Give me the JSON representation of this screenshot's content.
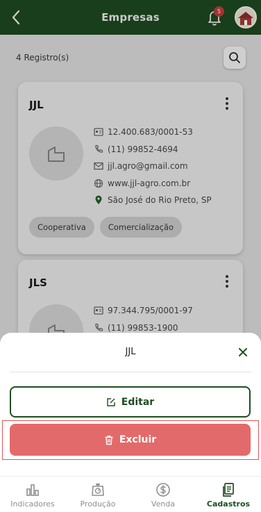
{
  "header": {
    "title": "Empresas",
    "notification_count": "5"
  },
  "list": {
    "count_label": "4 Registro(s)"
  },
  "companies": [
    {
      "name": "JJL",
      "cnpj": "12.400.683/0001-53",
      "phone": "(11) 99852-4694",
      "email": "jjl.agro@gmail.com",
      "website": "www.jjl-agro.com.br",
      "location": "São José do Rio Preto, SP",
      "tags": [
        "Cooperativa",
        "Comercialização"
      ]
    },
    {
      "name": "JLS",
      "cnpj": "97.344.795/0001-97",
      "phone": "(11) 99853-1900"
    }
  ],
  "sheet": {
    "title": "JJL",
    "edit_label": "Editar",
    "delete_label": "Excluir"
  },
  "nav": {
    "items": [
      {
        "label": "Indicadores"
      },
      {
        "label": "Produção"
      },
      {
        "label": "Venda"
      },
      {
        "label": "Cadastros"
      }
    ]
  },
  "colors": {
    "header_bg": "#193e1b",
    "primary_green": "#1f4d22",
    "danger": "#e36a6a",
    "badge": "#a13333"
  }
}
